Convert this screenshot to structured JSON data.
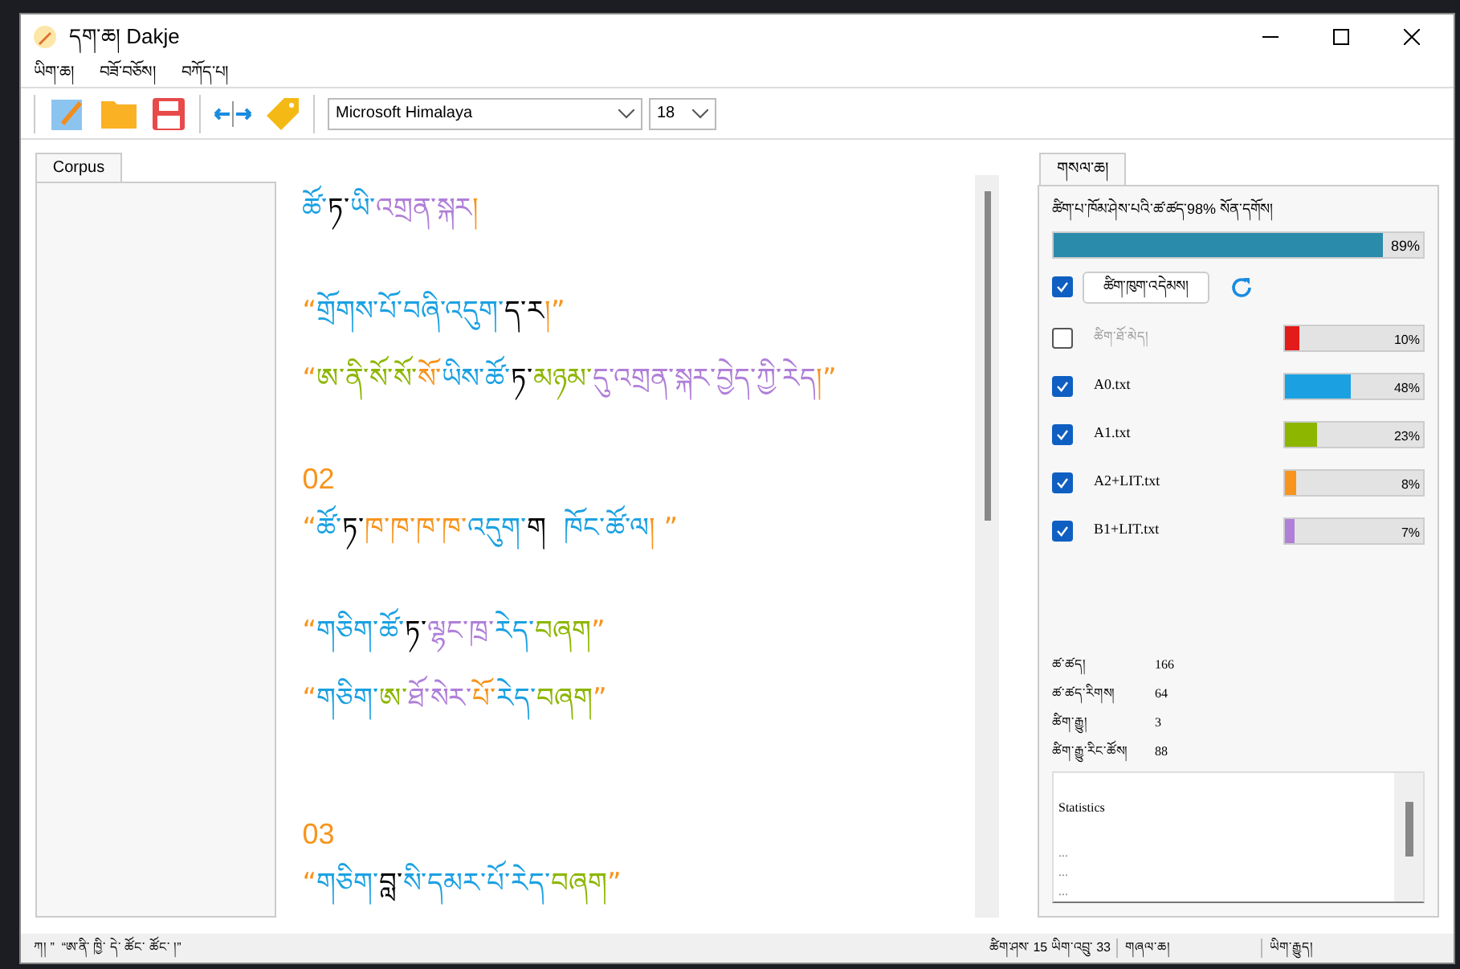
{
  "window": {
    "title": "དག་ཆ། Dakje"
  },
  "menu": [
    "ཡིག་ཆ།",
    "བཟོ་བཅོས།",
    "བཀོད་པ།"
  ],
  "toolbar": {
    "font": "Microsoft Himalaya",
    "size": "18"
  },
  "left_panel": {
    "tab": "Corpus"
  },
  "editor": {
    "lines": [
      {
        "kind": "text",
        "segments": [
          {
            "text": "ཚོ་",
            "color": "#1ba1e2"
          },
          {
            "text": "ཏ་",
            "color": "#000000"
          },
          {
            "text": "ཡི་",
            "color": "#1ba1e2"
          },
          {
            "text": "འགྲན་སྐར",
            "color": "#b07fd8"
          },
          {
            "text": "།",
            "color": "#f7941d"
          }
        ]
      },
      {
        "kind": "blank"
      },
      {
        "kind": "text",
        "segments": [
          {
            "text": "“",
            "color": "#f7941d"
          },
          {
            "text": "གྲོགས་པོ་བཞི་འདུག་",
            "color": "#1ba1e2"
          },
          {
            "text": "ད་ར",
            "color": "#000000"
          },
          {
            "text": "།”",
            "color": "#f7941d"
          }
        ]
      },
      {
        "kind": "text",
        "segments": [
          {
            "text": "“",
            "color": "#f7941d"
          },
          {
            "text": "ཨ་ནི་སོ་སོ་",
            "color": "#8db600"
          },
          {
            "text": "སོ་",
            "color": "#f7941d"
          },
          {
            "text": "ཡིས་ཚོ་",
            "color": "#1ba1e2"
          },
          {
            "text": "ཏ་",
            "color": "#000000"
          },
          {
            "text": "མཉམ་",
            "color": "#8db600"
          },
          {
            "text": "དུ་འགྲན་སྐར་བྱེད་ཀྱི་རེད",
            "color": "#b07fd8"
          },
          {
            "text": "།”",
            "color": "#f7941d"
          }
        ]
      },
      {
        "kind": "blank"
      },
      {
        "kind": "heading",
        "text": "02"
      },
      {
        "kind": "text",
        "segments": [
          {
            "text": "“",
            "color": "#f7941d"
          },
          {
            "text": "ཚོ་",
            "color": "#1ba1e2"
          },
          {
            "text": "ཏ་",
            "color": "#000000"
          },
          {
            "text": "ཁ་ཁ་ཁ་ཁ་",
            "color": "#f7941d"
          },
          {
            "text": "འདུག་",
            "color": "#1ba1e2"
          },
          {
            "text": "ག  ",
            "color": "#000000"
          },
          {
            "text": "ཁོང་ཚོ་ལ",
            "color": "#1ba1e2"
          },
          {
            "text": "། ”",
            "color": "#f7941d"
          }
        ]
      },
      {
        "kind": "blank"
      },
      {
        "kind": "text",
        "segments": [
          {
            "text": "“",
            "color": "#f7941d"
          },
          {
            "text": "གཅིག་ཚོ་",
            "color": "#1ba1e2"
          },
          {
            "text": "ཏ་",
            "color": "#000000"
          },
          {
            "text": "ལྷང་ཁྲ་",
            "color": "#b07fd8"
          },
          {
            "text": "རེད་",
            "color": "#1ba1e2"
          },
          {
            "text": "བཞག",
            "color": "#8db600"
          },
          {
            "text": "”",
            "color": "#f7941d"
          }
        ]
      },
      {
        "kind": "text",
        "segments": [
          {
            "text": "“",
            "color": "#f7941d"
          },
          {
            "text": "གཅིག་",
            "color": "#1ba1e2"
          },
          {
            "text": "ཨ་",
            "color": "#8db600"
          },
          {
            "text": "ཐོ་སེར་",
            "color": "#b07fd8"
          },
          {
            "text": "པོ་",
            "color": "#f7941d"
          },
          {
            "text": "རེད་",
            "color": "#1ba1e2"
          },
          {
            "text": "བཞག",
            "color": "#8db600"
          },
          {
            "text": "”",
            "color": "#f7941d"
          }
        ]
      },
      {
        "kind": "blank"
      },
      {
        "kind": "blank"
      },
      {
        "kind": "heading",
        "text": "03"
      },
      {
        "kind": "text",
        "segments": [
          {
            "text": "“",
            "color": "#f7941d"
          },
          {
            "text": "གཅིག་",
            "color": "#1ba1e2"
          },
          {
            "text": "བླ་",
            "color": "#000000"
          },
          {
            "text": "སི་དམར་པོ་རེད་",
            "color": "#1ba1e2"
          },
          {
            "text": "བཞག",
            "color": "#8db600"
          },
          {
            "text": "”",
            "color": "#f7941d"
          }
        ]
      }
    ]
  },
  "right_panel": {
    "tab": "གསལ་ཆ།",
    "coverage_label": "ཚིག་པ་ཁོམ་ཤེས་པའི་ཚ་ཚད་98% སོན་དགོས།",
    "coverage": {
      "level": 0.89,
      "reading": "89%"
    },
    "select_checked": true,
    "select_button": "ཚིག་ཁུག་འདེམས།",
    "lists": [
      {
        "name": "ཚིག་ཐོ་མེད།",
        "checked": false,
        "color": "#e31b1b",
        "level": 0.1,
        "reading": "10%"
      },
      {
        "name": "A0.txt",
        "checked": true,
        "color": "#1ba1e2",
        "level": 0.48,
        "reading": "48%"
      },
      {
        "name": "A1.txt",
        "checked": true,
        "color": "#8db600",
        "level": 0.23,
        "reading": "23%"
      },
      {
        "name": "A2+LIT.txt",
        "checked": true,
        "color": "#f7941d",
        "level": 0.08,
        "reading": "8%"
      },
      {
        "name": "B1+LIT.txt",
        "checked": true,
        "color": "#b07fd8",
        "level": 0.07,
        "reading": "7%"
      }
    ],
    "stats": [
      {
        "label": "ཚ་ཚད།",
        "value": "166"
      },
      {
        "label": "ཚ་ཚད་རིགས།",
        "value": "64"
      },
      {
        "label": "ཚིག་རྒྱུ།",
        "value": "3"
      },
      {
        "label": "ཚིག་རྒྱུ་རིང་ཚོས།",
        "value": "88"
      }
    ],
    "statistics_box": [
      "Statistics",
      "...",
      "...",
      "..."
    ]
  },
  "status_bar": {
    "left": "ཀ། ”  “ཨ་ནི་ ཁྱི་ དེ་ ཚོང་ ཚོང་ །”",
    "position": "ཚིག་ཤས་ 15 ཡིག་འབྲུ་ 33",
    "mode": "གཞལ་ཆ།",
    "encoding": "ཡིག་རྒྱུད།"
  }
}
